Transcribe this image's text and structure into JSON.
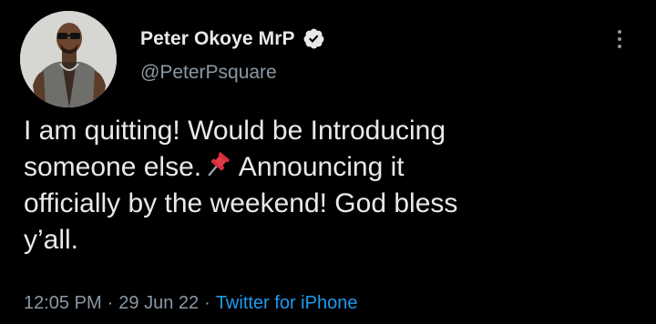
{
  "author": {
    "display_name": "Peter Okoye MrP",
    "handle": "@PeterPsquare",
    "verified": true,
    "avatar_icon": "profile-photo"
  },
  "tweet": {
    "line1": "I am quitting! Would be Introducing",
    "line2_a": "someone else.",
    "line2_b": " Announcing it",
    "line3": "officially by the weekend! God bless",
    "line4": "y’all.",
    "emoji": "pushpin"
  },
  "meta": {
    "time": "12:05 PM",
    "separator": "·",
    "date": "29 Jun 22",
    "source": "Twitter for iPhone"
  },
  "colors": {
    "background": "#000000",
    "text": "#e7e9ea",
    "secondary": "#8b98a5",
    "link": "#1d9bf0"
  }
}
